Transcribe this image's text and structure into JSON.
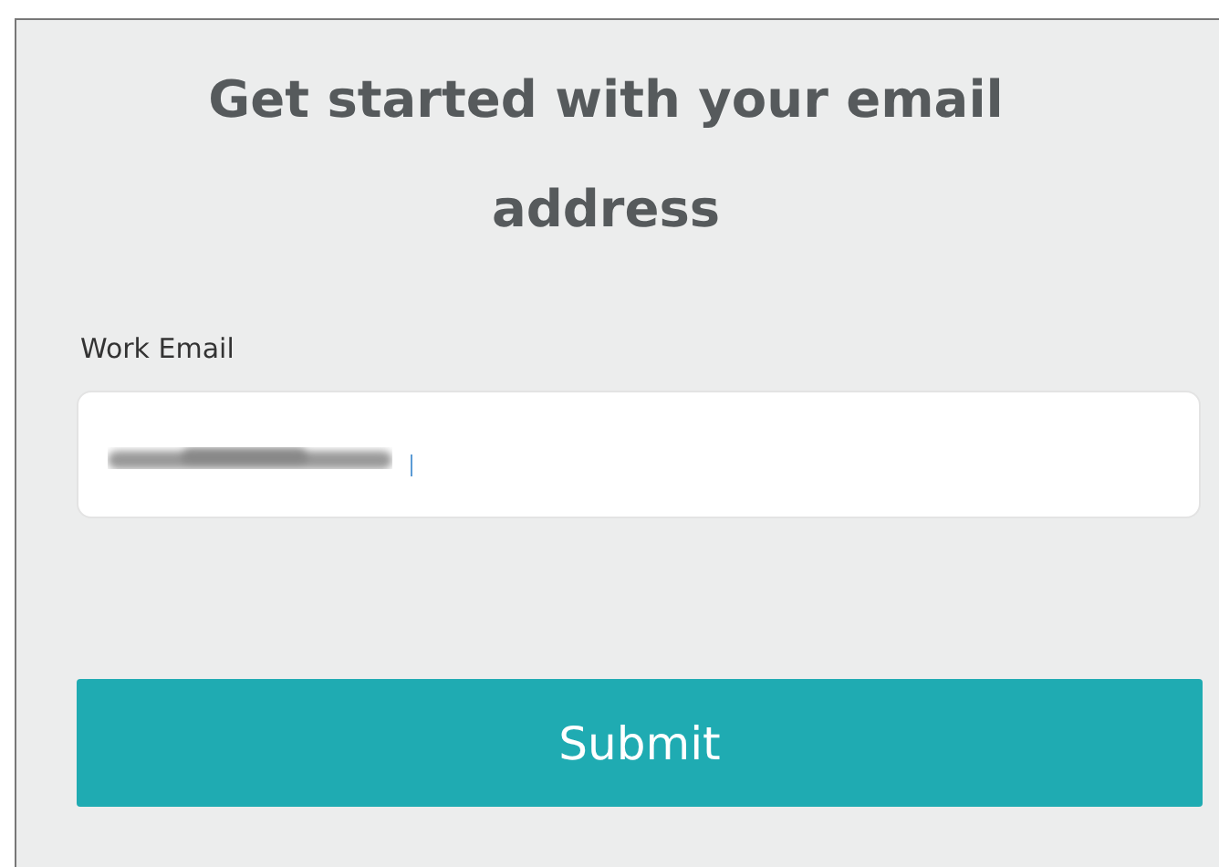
{
  "heading": "Get started with your email address",
  "email_field": {
    "label": "Work Email",
    "redacted": true,
    "focused": true
  },
  "submit_button": {
    "label": "Submit"
  }
}
